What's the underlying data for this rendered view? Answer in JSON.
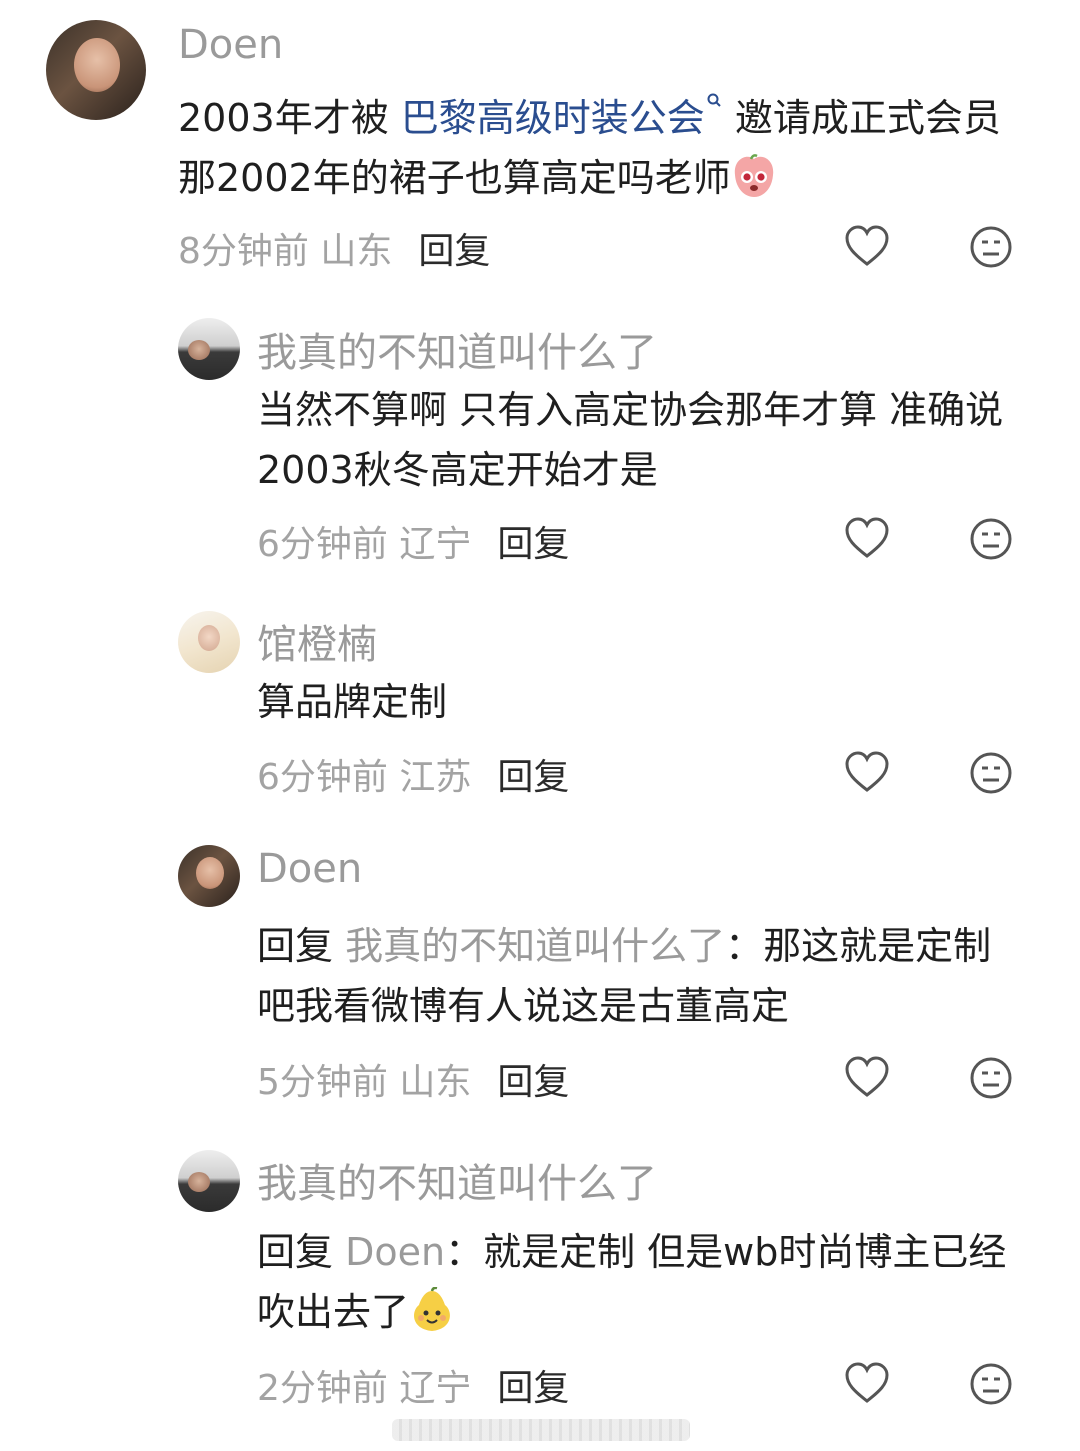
{
  "comments": [
    {
      "username": "Doen",
      "text_before_link": "2003年才被 ",
      "link_text": "巴黎高级时装公会",
      "text_after_link": " 邀请成正式会员那2002年的裙子也算高定吗老师",
      "time_location": "8分钟前 山东",
      "reply_label": "回复"
    },
    {
      "username": "我真的不知道叫什么了",
      "text": "当然不算啊 只有入高定协会那年才算 准确说2003秋冬高定开始才是",
      "time_location": "6分钟前 辽宁",
      "reply_label": "回复"
    },
    {
      "username": "馆橙楠",
      "text": "算品牌定制",
      "time_location": "6分钟前 江苏",
      "reply_label": "回复"
    },
    {
      "username": "Doen",
      "reply_prefix": "回复",
      "reply_to": "我真的不知道叫什么了",
      "text": "：那这就是定制吧我看微博有人说这是古董高定",
      "time_location": "5分钟前 山东",
      "reply_label": "回复"
    },
    {
      "username": "我真的不知道叫什么了",
      "reply_prefix": "回复",
      "reply_to": "Doen",
      "text": "：就是定制 但是wb时尚博主已经吹出去了",
      "time_location": "2分钟前 辽宁",
      "reply_label": "回复"
    }
  ],
  "icons": {
    "like": "heart-outline-icon",
    "dislike": "meh-face-icon",
    "search_hint": "search-icon",
    "emoji_1": "pink-peach-pleading-emoji",
    "emoji_2": "yellow-pear-smiling-emoji"
  },
  "colors": {
    "link": "#2a4d8f",
    "username": "#9a9a9a",
    "meta": "#a3a3a3"
  }
}
